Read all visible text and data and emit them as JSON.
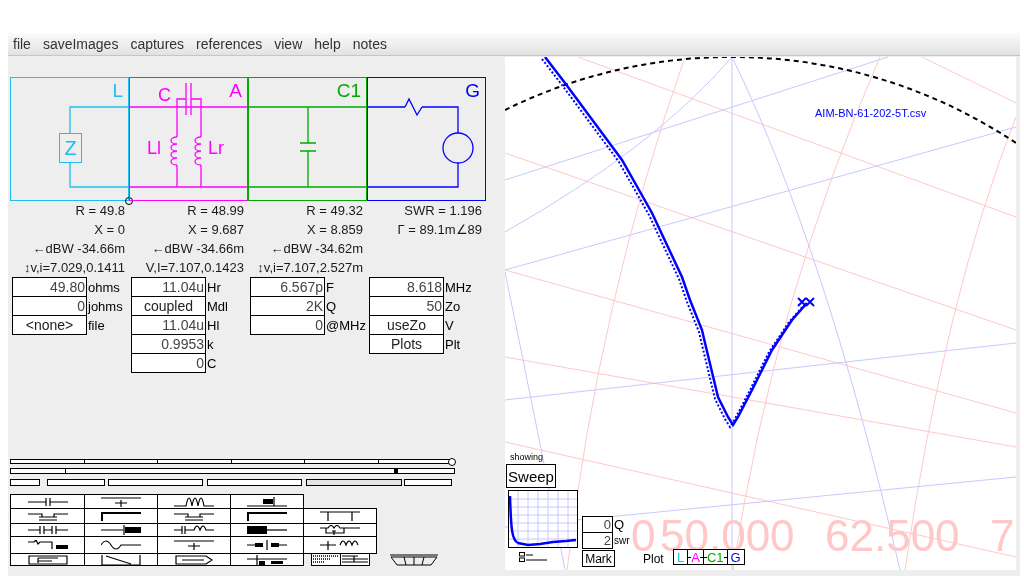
{
  "menu": [
    "file",
    "saveImages",
    "captures",
    "references",
    "view",
    "help",
    "notes"
  ],
  "sections": [
    {
      "label": "L",
      "color": "#1ebef0",
      "kind": "load",
      "symbol": "Z",
      "readouts": [
        "R = 49.8",
        "X = 0",
        "←dBW -34.66m",
        "↕v,i=7.029,0.1411"
      ],
      "fields": [
        {
          "kind": "field",
          "value": "49.80",
          "unit": "ohms"
        },
        {
          "kind": "field",
          "value": "0",
          "unit": "johms"
        },
        {
          "kind": "button",
          "value": "<none>",
          "unit": "file"
        }
      ]
    },
    {
      "label": "A",
      "color": "#ff00ff",
      "kind": "coupled_inductor",
      "parts": [
        "C",
        "Ll",
        "Lr"
      ],
      "readouts": [
        "R = 48.99",
        "X = 9.687",
        "←dBW -34.66m",
        "V,I=7.107,0.1423"
      ],
      "fields": [
        {
          "kind": "field",
          "value": "11.04u",
          "unit": "Hr"
        },
        {
          "kind": "button",
          "value": "coupled",
          "unit": "Mdl"
        },
        {
          "kind": "field",
          "value": "11.04u",
          "unit": "Hl"
        },
        {
          "kind": "field",
          "value": "0.9953",
          "unit": "k"
        },
        {
          "kind": "field",
          "value": "0",
          "unit": "C"
        }
      ]
    },
    {
      "label": "C1",
      "color": "#00aa00",
      "kind": "shunt_capacitor",
      "readouts": [
        "R = 49.32",
        "X = 8.859",
        "←dBW -34.62m",
        "↕v,i=7.107,2.527m"
      ],
      "fields": [
        {
          "kind": "field",
          "value": "6.567p",
          "unit": "F"
        },
        {
          "kind": "field",
          "value": "2K",
          "unit": "Q"
        },
        {
          "kind": "field",
          "value": "0",
          "unit": "@MHz"
        }
      ]
    },
    {
      "label": "G",
      "color": "#0000ff",
      "kind": "generator",
      "readouts": [
        "SWR = 1.196",
        "Γ = 89.1m∠89"
      ],
      "fields": [
        {
          "kind": "field",
          "value": "8.618",
          "unit": "MHz"
        },
        {
          "kind": "field",
          "value": "50",
          "unit": "Zo"
        },
        {
          "kind": "button",
          "value": "useZo",
          "unit": "V"
        },
        {
          "kind": "button",
          "value": "Plots",
          "unit": "Plt"
        }
      ]
    }
  ],
  "sliders": [
    {
      "level": 1
    },
    {
      "level": 0.87
    }
  ],
  "smith_chart": {
    "file_label": "AIM-BN-61-202-5T.csv",
    "frequency_labels": [
      "0",
      "50.000",
      "62.500",
      "7"
    ],
    "showing_label": "showing",
    "sweep_button": "Sweep",
    "q_field": {
      "value": "0",
      "unit": "Q"
    },
    "swr_field": {
      "value": "2",
      "unit": "swr"
    },
    "mark_button": "Mark",
    "plot_label": "Plot",
    "plot_toggles": [
      {
        "label": "L",
        "color": "#1ebef0",
        "enabled": true
      },
      {
        "label": "A",
        "color": "#ff00ff",
        "enabled": false
      },
      {
        "label": "C1",
        "color": "#00aa00",
        "enabled": false
      },
      {
        "label": "G",
        "color": "#0000ff",
        "enabled": true
      }
    ]
  }
}
